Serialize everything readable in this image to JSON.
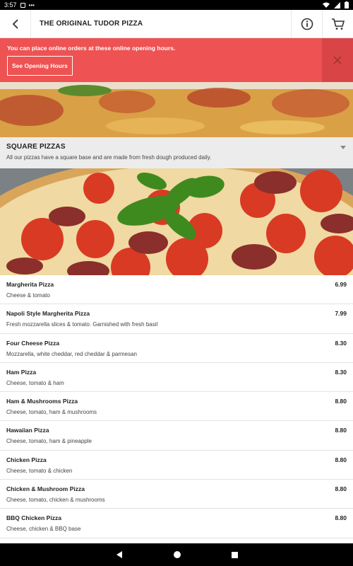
{
  "status_bar": {
    "time": "3:57"
  },
  "app_bar": {
    "title": "THE ORIGINAL TUDOR PIZZA",
    "back_icon": "chevron-left-icon",
    "info_icon": "info-icon",
    "cart_icon": "cart-icon"
  },
  "banner": {
    "message": "You can place online orders at these online opening hours.",
    "button_label": "See Opening Hours",
    "close_icon": "close-icon",
    "color": "#ee5253"
  },
  "section": {
    "title": "SQUARE PIZZAS",
    "description": "All our pizzas have a square base and are made from fresh dough produced daily."
  },
  "menu_items": [
    {
      "name": "Margherita Pizza",
      "description": "Cheese & tomato",
      "price": "6.99"
    },
    {
      "name": "Napoli Style Margherita Pizza",
      "description": "Fresh mozzarella slices & tomato. Garnished with fresh basil",
      "price": "7.99"
    },
    {
      "name": "Four Cheese Pizza",
      "description": "Mozzarella, white cheddar, red cheddar & parmesan",
      "price": "8.30"
    },
    {
      "name": "Ham Pizza",
      "description": "Cheese, tomato & ham",
      "price": "8.30"
    },
    {
      "name": "Ham & Mushrooms Pizza",
      "description": "Cheese, tomato, ham & mushrooms",
      "price": "8.80"
    },
    {
      "name": "Hawaiian Pizza",
      "description": "Cheese, tomato, ham & pineapple",
      "price": "8.80"
    },
    {
      "name": "Chicken Pizza",
      "description": "Cheese, tomato & chicken",
      "price": "8.80"
    },
    {
      "name": "Chicken & Mushroom Pizza",
      "description": "Cheese, tomato, chicken & mushrooms",
      "price": "8.80"
    },
    {
      "name": "BBQ Chicken Pizza",
      "description": "Cheese, chicken & BBQ base",
      "price": "8.80"
    }
  ]
}
